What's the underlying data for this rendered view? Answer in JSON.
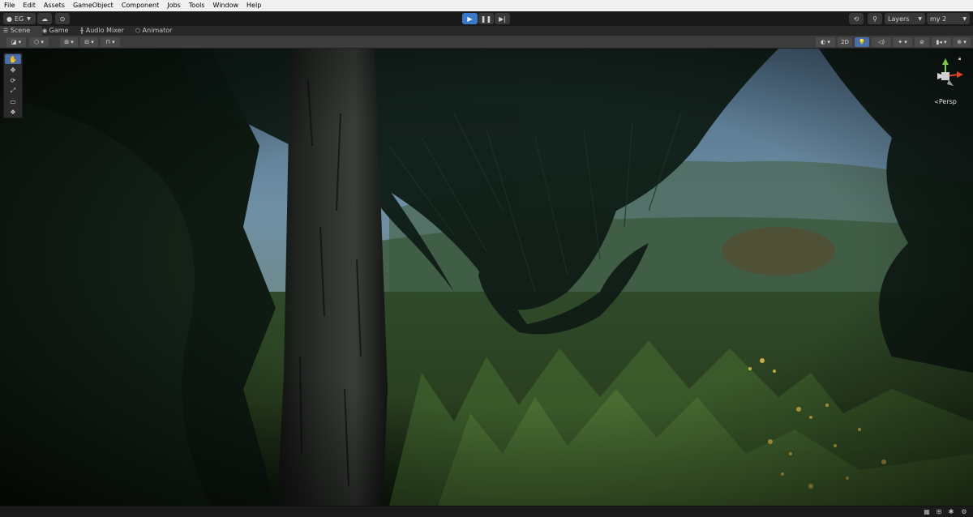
{
  "menu": {
    "items": [
      "File",
      "Edit",
      "Assets",
      "GameObject",
      "Component",
      "Jobs",
      "Tools",
      "Window",
      "Help"
    ]
  },
  "toolbar": {
    "account_label": "EG",
    "layers_label": "Layers",
    "layout_label": "my 2"
  },
  "tabs": [
    {
      "label": "Scene",
      "icon": "scene-icon"
    },
    {
      "label": "Game",
      "icon": "game-icon"
    },
    {
      "label": "Audio Mixer",
      "icon": "audio-mixer-icon"
    },
    {
      "label": "Animator",
      "icon": "animator-icon"
    }
  ],
  "scene_toolbar": {
    "mode_2d_label": "2D"
  },
  "scene": {
    "projection_label": "Persp"
  },
  "tools": [
    {
      "name": "hand-tool",
      "glyph": "✋"
    },
    {
      "name": "move-tool",
      "glyph": "✥"
    },
    {
      "name": "rotate-tool",
      "glyph": "⟳"
    },
    {
      "name": "scale-tool",
      "glyph": "⤢"
    },
    {
      "name": "rect-tool",
      "glyph": "▭"
    },
    {
      "name": "transform-tool",
      "glyph": "❖"
    }
  ],
  "colors": {
    "accent": "#4b6ea8",
    "play_active": "#3a78c8"
  }
}
